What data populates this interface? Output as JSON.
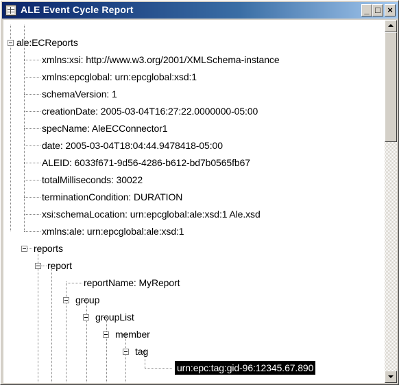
{
  "window": {
    "title": "ALE Event Cycle Report",
    "minimize_label": "_",
    "maximize_label": "□",
    "close_label": "×"
  },
  "tree": {
    "nodes": [
      {
        "label": "ale:ECReports"
      },
      {
        "label": "xmlns:xsi: http://www.w3.org/2001/XMLSchema-instance"
      },
      {
        "label": "xmlns:epcglobal: urn:epcglobal:xsd:1"
      },
      {
        "label": "schemaVersion: 1"
      },
      {
        "label": "creationDate: 2005-03-04T16:27:22.0000000-05:00"
      },
      {
        "label": "specName: AleECConnector1"
      },
      {
        "label": "date: 2005-03-04T18:04:44.9478418-05:00"
      },
      {
        "label": "ALEID: 6033f671-9d56-4286-b612-bd7b0565fb67"
      },
      {
        "label": "totalMilliseconds: 30022"
      },
      {
        "label": "terminationCondition: DURATION"
      },
      {
        "label": "xsi:schemaLocation: urn:epcglobal:ale:xsd:1 Ale.xsd"
      },
      {
        "label": "xmlns:ale: urn:epcglobal:ale:xsd:1"
      },
      {
        "label": "reports"
      },
      {
        "label": "report"
      },
      {
        "label": "reportName: MyReport"
      },
      {
        "label": "group"
      },
      {
        "label": "groupList"
      },
      {
        "label": "member"
      },
      {
        "label": "tag"
      },
      {
        "label": "urn:epc:tag:gid-96:12345.67.890"
      }
    ]
  }
}
